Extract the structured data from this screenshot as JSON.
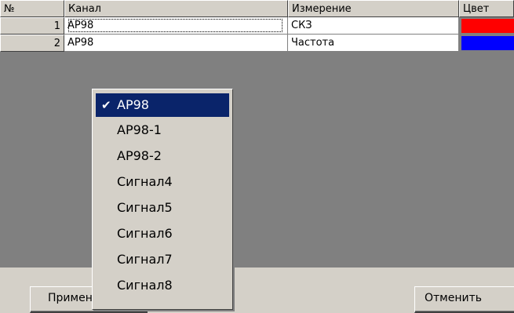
{
  "table": {
    "headers": {
      "num": "№",
      "channel": "Канал",
      "measure": "Измерение",
      "color": "Цвет"
    },
    "rows": [
      {
        "num": "1",
        "channel": "AP98",
        "measure": "СКЗ",
        "color": "#ff0000"
      },
      {
        "num": "2",
        "channel": "AP98",
        "measure": "Частота",
        "color": "#0000ff"
      }
    ]
  },
  "dropdown": {
    "selected": "AP98",
    "items": [
      "AP98",
      "AP98-1",
      "AP98-2",
      "Сигнал4",
      "Сигнал5",
      "Сигнал6",
      "Сигнал7",
      "Сигнал8"
    ],
    "check_icon": "✔"
  },
  "buttons": {
    "apply": "Примени",
    "cancel": "Отменить"
  }
}
